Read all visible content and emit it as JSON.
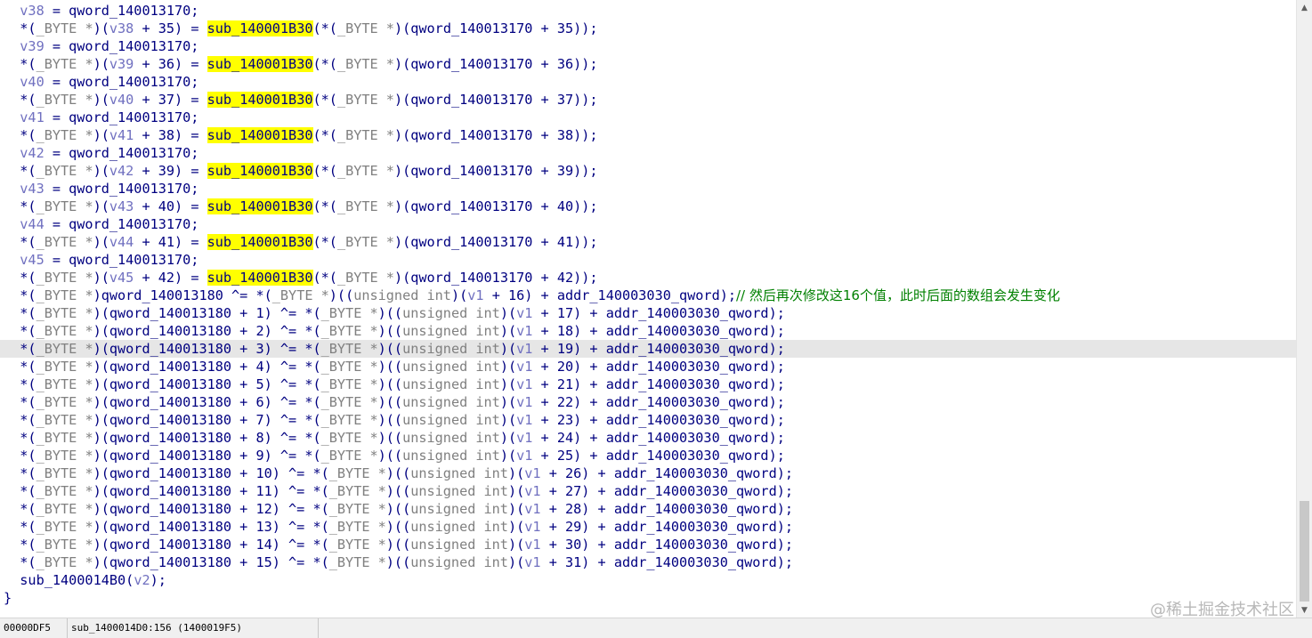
{
  "editor": {
    "current_line_index": 19,
    "lines": [
      [
        [
          "var",
          "  v38"
        ],
        [
          "id",
          " = qword_140013170;"
        ]
      ],
      [
        [
          "id",
          "  *("
        ],
        [
          "kw",
          "_BYTE *"
        ],
        [
          "id",
          ")("
        ],
        [
          "var",
          "v38"
        ],
        [
          "id",
          " + 35) = "
        ],
        [
          "hl",
          "sub_140001B30"
        ],
        [
          "id",
          "(*("
        ],
        [
          "kw",
          "_BYTE *"
        ],
        [
          "id",
          ")(qword_140013170 + 35));"
        ]
      ],
      [
        [
          "var",
          "  v39"
        ],
        [
          "id",
          " = qword_140013170;"
        ]
      ],
      [
        [
          "id",
          "  *("
        ],
        [
          "kw",
          "_BYTE *"
        ],
        [
          "id",
          ")("
        ],
        [
          "var",
          "v39"
        ],
        [
          "id",
          " + 36) = "
        ],
        [
          "hl",
          "sub_140001B30"
        ],
        [
          "id",
          "(*("
        ],
        [
          "kw",
          "_BYTE *"
        ],
        [
          "id",
          ")(qword_140013170 + 36));"
        ]
      ],
      [
        [
          "var",
          "  v40"
        ],
        [
          "id",
          " = qword_140013170;"
        ]
      ],
      [
        [
          "id",
          "  *("
        ],
        [
          "kw",
          "_BYTE *"
        ],
        [
          "id",
          ")("
        ],
        [
          "var",
          "v40"
        ],
        [
          "id",
          " + 37) = "
        ],
        [
          "hl",
          "sub_140001B30"
        ],
        [
          "id",
          "(*("
        ],
        [
          "kw",
          "_BYTE *"
        ],
        [
          "id",
          ")(qword_140013170 + 37));"
        ]
      ],
      [
        [
          "var",
          "  v41"
        ],
        [
          "id",
          " = qword_140013170;"
        ]
      ],
      [
        [
          "id",
          "  *("
        ],
        [
          "kw",
          "_BYTE *"
        ],
        [
          "id",
          ")("
        ],
        [
          "var",
          "v41"
        ],
        [
          "id",
          " + 38) = "
        ],
        [
          "hl",
          "sub_140001B30"
        ],
        [
          "id",
          "(*("
        ],
        [
          "kw",
          "_BYTE *"
        ],
        [
          "id",
          ")(qword_140013170 + 38));"
        ]
      ],
      [
        [
          "var",
          "  v42"
        ],
        [
          "id",
          " = qword_140013170;"
        ]
      ],
      [
        [
          "id",
          "  *("
        ],
        [
          "kw",
          "_BYTE *"
        ],
        [
          "id",
          ")("
        ],
        [
          "var",
          "v42"
        ],
        [
          "id",
          " + 39) = "
        ],
        [
          "hl",
          "sub_140001B30"
        ],
        [
          "id",
          "(*("
        ],
        [
          "kw",
          "_BYTE *"
        ],
        [
          "id",
          ")(qword_140013170 + 39));"
        ]
      ],
      [
        [
          "var",
          "  v43"
        ],
        [
          "id",
          " = qword_140013170;"
        ]
      ],
      [
        [
          "id",
          "  *("
        ],
        [
          "kw",
          "_BYTE *"
        ],
        [
          "id",
          ")("
        ],
        [
          "var",
          "v43"
        ],
        [
          "id",
          " + 40) = "
        ],
        [
          "hl",
          "sub_140001B30"
        ],
        [
          "id",
          "(*("
        ],
        [
          "kw",
          "_BYTE *"
        ],
        [
          "id",
          ")(qword_140013170 + 40));"
        ]
      ],
      [
        [
          "var",
          "  v44"
        ],
        [
          "id",
          " = qword_140013170;"
        ]
      ],
      [
        [
          "id",
          "  *("
        ],
        [
          "kw",
          "_BYTE *"
        ],
        [
          "id",
          ")("
        ],
        [
          "var",
          "v44"
        ],
        [
          "id",
          " + 41) = "
        ],
        [
          "hl",
          "sub_140001B30"
        ],
        [
          "id",
          "(*("
        ],
        [
          "kw",
          "_BYTE *"
        ],
        [
          "id",
          ")(qword_140013170 + 41));"
        ]
      ],
      [
        [
          "var",
          "  v45"
        ],
        [
          "id",
          " = qword_140013170;"
        ]
      ],
      [
        [
          "id",
          "  *("
        ],
        [
          "kw",
          "_BYTE *"
        ],
        [
          "id",
          ")("
        ],
        [
          "var",
          "v45"
        ],
        [
          "id",
          " + 42) = "
        ],
        [
          "hl",
          "sub_140001B30"
        ],
        [
          "id",
          "(*("
        ],
        [
          "kw",
          "_BYTE *"
        ],
        [
          "id",
          ")(qword_140013170 + 42));"
        ]
      ],
      [
        [
          "id",
          "  *("
        ],
        [
          "kw",
          "_BYTE *"
        ],
        [
          "id",
          ")qword_140013180 ^= *("
        ],
        [
          "kw",
          "_BYTE *"
        ],
        [
          "id",
          ")(("
        ],
        [
          "kw",
          "unsigned int"
        ],
        [
          "id",
          ")("
        ],
        [
          "var",
          "v1"
        ],
        [
          "id",
          " + 16) + addr_140003030_qword);"
        ],
        [
          "cm",
          "// 然后再次修改这16个值，此时后面的数组会发生变化"
        ]
      ],
      [
        [
          "id",
          "  *("
        ],
        [
          "kw",
          "_BYTE *"
        ],
        [
          "id",
          ")(qword_140013180 + 1) ^= *("
        ],
        [
          "kw",
          "_BYTE *"
        ],
        [
          "id",
          ")(("
        ],
        [
          "kw",
          "unsigned int"
        ],
        [
          "id",
          ")("
        ],
        [
          "var",
          "v1"
        ],
        [
          "id",
          " + 17) + addr_140003030_qword);"
        ]
      ],
      [
        [
          "id",
          "  *("
        ],
        [
          "kw",
          "_BYTE *"
        ],
        [
          "id",
          ")(qword_140013180 + 2) ^= *("
        ],
        [
          "kw",
          "_BYTE *"
        ],
        [
          "id",
          ")(("
        ],
        [
          "kw",
          "unsigned int"
        ],
        [
          "id",
          ")("
        ],
        [
          "var",
          "v1"
        ],
        [
          "id",
          " + 18) + addr_140003030_qword);"
        ]
      ],
      [
        [
          "id",
          "  *("
        ],
        [
          "kw",
          "_BYTE *"
        ],
        [
          "id",
          ")(qword_140013180 + 3) ^= *("
        ],
        [
          "kw",
          "_BYTE *"
        ],
        [
          "id",
          ")(("
        ],
        [
          "kw",
          "unsigned int"
        ],
        [
          "id",
          ")("
        ],
        [
          "var",
          "v1"
        ],
        [
          "id",
          " + 19) + addr_140003030_qword);"
        ]
      ],
      [
        [
          "id",
          "  *("
        ],
        [
          "kw",
          "_BYTE *"
        ],
        [
          "id",
          ")(qword_140013180 + 4) ^= *("
        ],
        [
          "kw",
          "_BYTE *"
        ],
        [
          "id",
          ")(("
        ],
        [
          "kw",
          "unsigned int"
        ],
        [
          "id",
          ")("
        ],
        [
          "var",
          "v1"
        ],
        [
          "id",
          " + 20) + addr_140003030_qword);"
        ]
      ],
      [
        [
          "id",
          "  *("
        ],
        [
          "kw",
          "_BYTE *"
        ],
        [
          "id",
          ")(qword_140013180 + 5) ^= *("
        ],
        [
          "kw",
          "_BYTE *"
        ],
        [
          "id",
          ")(("
        ],
        [
          "kw",
          "unsigned int"
        ],
        [
          "id",
          ")("
        ],
        [
          "var",
          "v1"
        ],
        [
          "id",
          " + 21) + addr_140003030_qword);"
        ]
      ],
      [
        [
          "id",
          "  *("
        ],
        [
          "kw",
          "_BYTE *"
        ],
        [
          "id",
          ")(qword_140013180 + 6) ^= *("
        ],
        [
          "kw",
          "_BYTE *"
        ],
        [
          "id",
          ")(("
        ],
        [
          "kw",
          "unsigned int"
        ],
        [
          "id",
          ")("
        ],
        [
          "var",
          "v1"
        ],
        [
          "id",
          " + 22) + addr_140003030_qword);"
        ]
      ],
      [
        [
          "id",
          "  *("
        ],
        [
          "kw",
          "_BYTE *"
        ],
        [
          "id",
          ")(qword_140013180 + 7) ^= *("
        ],
        [
          "kw",
          "_BYTE *"
        ],
        [
          "id",
          ")(("
        ],
        [
          "kw",
          "unsigned int"
        ],
        [
          "id",
          ")("
        ],
        [
          "var",
          "v1"
        ],
        [
          "id",
          " + 23) + addr_140003030_qword);"
        ]
      ],
      [
        [
          "id",
          "  *("
        ],
        [
          "kw",
          "_BYTE *"
        ],
        [
          "id",
          ")(qword_140013180 + 8) ^= *("
        ],
        [
          "kw",
          "_BYTE *"
        ],
        [
          "id",
          ")(("
        ],
        [
          "kw",
          "unsigned int"
        ],
        [
          "id",
          ")("
        ],
        [
          "var",
          "v1"
        ],
        [
          "id",
          " + 24) + addr_140003030_qword);"
        ]
      ],
      [
        [
          "id",
          "  *("
        ],
        [
          "kw",
          "_BYTE *"
        ],
        [
          "id",
          ")(qword_140013180 + 9) ^= *("
        ],
        [
          "kw",
          "_BYTE *"
        ],
        [
          "id",
          ")(("
        ],
        [
          "kw",
          "unsigned int"
        ],
        [
          "id",
          ")("
        ],
        [
          "var",
          "v1"
        ],
        [
          "id",
          " + 25) + addr_140003030_qword);"
        ]
      ],
      [
        [
          "id",
          "  *("
        ],
        [
          "kw",
          "_BYTE *"
        ],
        [
          "id",
          ")(qword_140013180 + 10) ^= *("
        ],
        [
          "kw",
          "_BYTE *"
        ],
        [
          "id",
          ")(("
        ],
        [
          "kw",
          "unsigned int"
        ],
        [
          "id",
          ")("
        ],
        [
          "var",
          "v1"
        ],
        [
          "id",
          " + 26) + addr_140003030_qword);"
        ]
      ],
      [
        [
          "id",
          "  *("
        ],
        [
          "kw",
          "_BYTE *"
        ],
        [
          "id",
          ")(qword_140013180 + 11) ^= *("
        ],
        [
          "kw",
          "_BYTE *"
        ],
        [
          "id",
          ")(("
        ],
        [
          "kw",
          "unsigned int"
        ],
        [
          "id",
          ")("
        ],
        [
          "var",
          "v1"
        ],
        [
          "id",
          " + 27) + addr_140003030_qword);"
        ]
      ],
      [
        [
          "id",
          "  *("
        ],
        [
          "kw",
          "_BYTE *"
        ],
        [
          "id",
          ")(qword_140013180 + 12) ^= *("
        ],
        [
          "kw",
          "_BYTE *"
        ],
        [
          "id",
          ")(("
        ],
        [
          "kw",
          "unsigned int"
        ],
        [
          "id",
          ")("
        ],
        [
          "var",
          "v1"
        ],
        [
          "id",
          " + 28) + addr_140003030_qword);"
        ]
      ],
      [
        [
          "id",
          "  *("
        ],
        [
          "kw",
          "_BYTE *"
        ],
        [
          "id",
          ")(qword_140013180 + 13) ^= *("
        ],
        [
          "kw",
          "_BYTE *"
        ],
        [
          "id",
          ")(("
        ],
        [
          "kw",
          "unsigned int"
        ],
        [
          "id",
          ")("
        ],
        [
          "var",
          "v1"
        ],
        [
          "id",
          " + 29) + addr_140003030_qword);"
        ]
      ],
      [
        [
          "id",
          "  *("
        ],
        [
          "kw",
          "_BYTE *"
        ],
        [
          "id",
          ")(qword_140013180 + 14) ^= *("
        ],
        [
          "kw",
          "_BYTE *"
        ],
        [
          "id",
          ")(("
        ],
        [
          "kw",
          "unsigned int"
        ],
        [
          "id",
          ")("
        ],
        [
          "var",
          "v1"
        ],
        [
          "id",
          " + 30) + addr_140003030_qword);"
        ]
      ],
      [
        [
          "id",
          "  *("
        ],
        [
          "kw",
          "_BYTE *"
        ],
        [
          "id",
          ")(qword_140013180 + 15) ^= *("
        ],
        [
          "kw",
          "_BYTE *"
        ],
        [
          "id",
          ")(("
        ],
        [
          "kw",
          "unsigned int"
        ],
        [
          "id",
          ")("
        ],
        [
          "var",
          "v1"
        ],
        [
          "id",
          " + 31) + addr_140003030_qword);"
        ]
      ],
      [
        [
          "id",
          "  sub_1400014B0("
        ],
        [
          "var",
          "v2"
        ],
        [
          "id",
          ");"
        ]
      ],
      [
        [
          "id",
          "}"
        ]
      ]
    ]
  },
  "scrollbar": {
    "up_arrow": "▲",
    "down_arrow": "▼"
  },
  "statusbar": {
    "address": "00000DF5",
    "location": "sub_1400014D0:156 (1400019F5)"
  },
  "watermark": "@稀土掘金技术社区",
  "colors": {
    "identifier": "#000080",
    "variable": "#7070c0",
    "keyword": "#808080",
    "highlight": "#ffff00",
    "comment": "#008000",
    "current_line": "#e6e6e6"
  }
}
